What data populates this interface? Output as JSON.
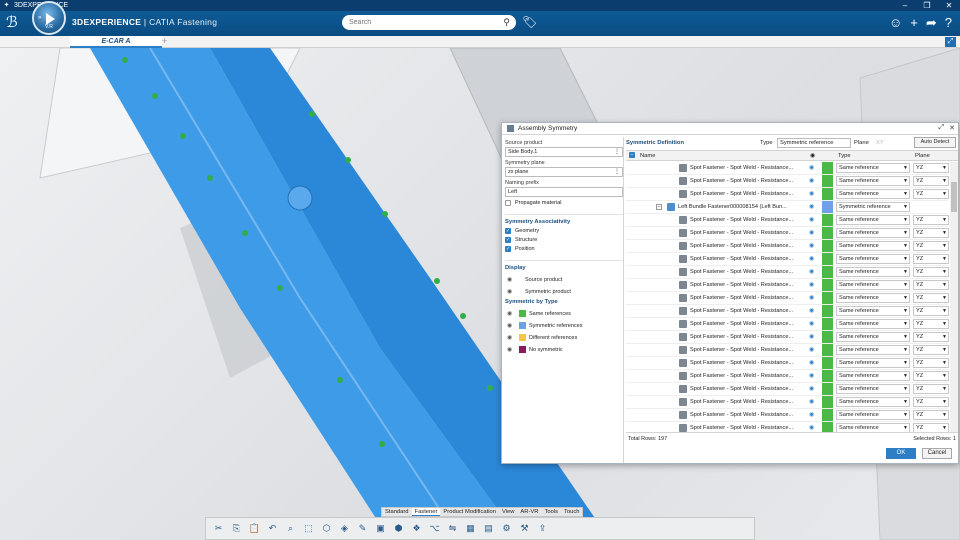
{
  "window": {
    "title": "3DEXPERIENCE"
  },
  "header": {
    "brand_bold": "3DEXPERIENCE",
    "brand_sep": " | ",
    "brand_app": "CATIA",
    "brand_module": " Fastening",
    "compass_version": "V.R",
    "search_placeholder": "Search"
  },
  "tabs": [
    {
      "label": "E-CAR A"
    }
  ],
  "tab_add": "+",
  "dialog": {
    "title": "Assembly Symmetry",
    "source_product_label": "Source product",
    "source_product_value": "Side Body.1",
    "symmetry_plane_label": "Symmetry plane",
    "symmetry_plane_value": "zx plane",
    "naming_prefix_label": "Naming prefix",
    "naming_prefix_value": "Left",
    "propagate_material": "Propagate material",
    "assoc_header": "Symmetry Associativity",
    "assoc_items": [
      "Geometry",
      "Structure",
      "Position"
    ],
    "display_header": "Display",
    "display_items": [
      "Source product",
      "Symmetric product"
    ],
    "bytype_header": "Symmetric by Type",
    "bytype_items": [
      {
        "label": "Same references",
        "color": "#4cb847"
      },
      {
        "label": "Symmetric references",
        "color": "#6fa0e8"
      },
      {
        "label": "Different references",
        "color": "#f5c842"
      },
      {
        "label": "No symmetric",
        "color": "#8a1a5c"
      }
    ],
    "symdef_title": "Symmetric Definition",
    "type_label": "Type",
    "type_value": "Symmetric reference",
    "plane_label": "Plane",
    "plane_value": "XY",
    "auto_detect": "Auto Detect",
    "col_name": "Name",
    "col_type": "Type",
    "col_plane": "Plane",
    "rows": [
      {
        "name": "Spot Fastener - Spot Weld - Resistance...",
        "type": "Same reference",
        "plane": "YZ",
        "color": "#4cb847",
        "indent": 1
      },
      {
        "name": "Spot Fastener - Spot Weld - Resistance...",
        "type": "Same reference",
        "plane": "YZ",
        "color": "#4cb847",
        "indent": 1
      },
      {
        "name": "Spot Fastener - Spot Weld - Resistance...",
        "type": "Same reference",
        "plane": "YZ",
        "color": "#4cb847",
        "indent": 1
      },
      {
        "name": "Left Bundle Fastener000008154 (Left Bun...",
        "type": "Symmetric reference",
        "plane": "",
        "color": "#6fa0e8",
        "indent": 0
      },
      {
        "name": "Spot Fastener - Spot Weld - Resistance...",
        "type": "Same reference",
        "plane": "YZ",
        "color": "#4cb847",
        "indent": 1
      },
      {
        "name": "Spot Fastener - Spot Weld - Resistance...",
        "type": "Same reference",
        "plane": "YZ",
        "color": "#4cb847",
        "indent": 1
      },
      {
        "name": "Spot Fastener - Spot Weld - Resistance...",
        "type": "Same reference",
        "plane": "YZ",
        "color": "#4cb847",
        "indent": 1
      },
      {
        "name": "Spot Fastener - Spot Weld - Resistance...",
        "type": "Same reference",
        "plane": "YZ",
        "color": "#4cb847",
        "indent": 1
      },
      {
        "name": "Spot Fastener - Spot Weld - Resistance...",
        "type": "Same reference",
        "plane": "YZ",
        "color": "#4cb847",
        "indent": 1
      },
      {
        "name": "Spot Fastener - Spot Weld - Resistance...",
        "type": "Same reference",
        "plane": "YZ",
        "color": "#4cb847",
        "indent": 1
      },
      {
        "name": "Spot Fastener - Spot Weld - Resistance...",
        "type": "Same reference",
        "plane": "YZ",
        "color": "#4cb847",
        "indent": 1
      },
      {
        "name": "Spot Fastener - Spot Weld - Resistance...",
        "type": "Same reference",
        "plane": "YZ",
        "color": "#4cb847",
        "indent": 1
      },
      {
        "name": "Spot Fastener - Spot Weld - Resistance...",
        "type": "Same reference",
        "plane": "YZ",
        "color": "#4cb847",
        "indent": 1
      },
      {
        "name": "Spot Fastener - Spot Weld - Resistance...",
        "type": "Same reference",
        "plane": "YZ",
        "color": "#4cb847",
        "indent": 1
      },
      {
        "name": "Spot Fastener - Spot Weld - Resistance...",
        "type": "Same reference",
        "plane": "YZ",
        "color": "#4cb847",
        "indent": 1
      },
      {
        "name": "Spot Fastener - Spot Weld - Resistance...",
        "type": "Same reference",
        "plane": "YZ",
        "color": "#4cb847",
        "indent": 1
      },
      {
        "name": "Spot Fastener - Spot Weld - Resistance...",
        "type": "Same reference",
        "plane": "YZ",
        "color": "#4cb847",
        "indent": 1
      },
      {
        "name": "Spot Fastener - Spot Weld - Resistance...",
        "type": "Same reference",
        "plane": "YZ",
        "color": "#4cb847",
        "indent": 1
      },
      {
        "name": "Spot Fastener - Spot Weld - Resistance...",
        "type": "Same reference",
        "plane": "YZ",
        "color": "#4cb847",
        "indent": 1
      },
      {
        "name": "Spot Fastener - Spot Weld - Resistance...",
        "type": "Same reference",
        "plane": "YZ",
        "color": "#4cb847",
        "indent": 1
      },
      {
        "name": "Spot Fastener - Spot Weld - Resistance...",
        "type": "Same reference",
        "plane": "YZ",
        "color": "#4cb847",
        "indent": 1
      }
    ],
    "total_rows": "Total Rows: 197",
    "selected_rows": "Selected Rows: 1",
    "ok": "OK",
    "cancel": "Cancel"
  },
  "action_tabs": [
    {
      "label": "Standard",
      "active": false
    },
    {
      "label": "Fastener",
      "active": true
    },
    {
      "label": "Product Modification",
      "active": false
    },
    {
      "label": "View",
      "active": false
    },
    {
      "label": "AR-VR",
      "active": false
    },
    {
      "label": "Tools",
      "active": false
    },
    {
      "label": "Touch",
      "active": false
    }
  ],
  "action_icons": [
    "cut-icon",
    "copy-icon",
    "paste-icon",
    "undo-icon",
    "zoom-icon",
    "select-icon",
    "fastener-icon",
    "cube-icon",
    "pencil-icon",
    "box-icon",
    "part-icon",
    "assembly-icon",
    "tree-icon",
    "symmetry-icon",
    "grid-icon",
    "table-icon",
    "gear-icon",
    "settings-icon",
    "export-icon"
  ],
  "colors": {
    "accent": "#2d7ec4",
    "header": "#0a4c82",
    "part_blue": "#3e9be8"
  }
}
